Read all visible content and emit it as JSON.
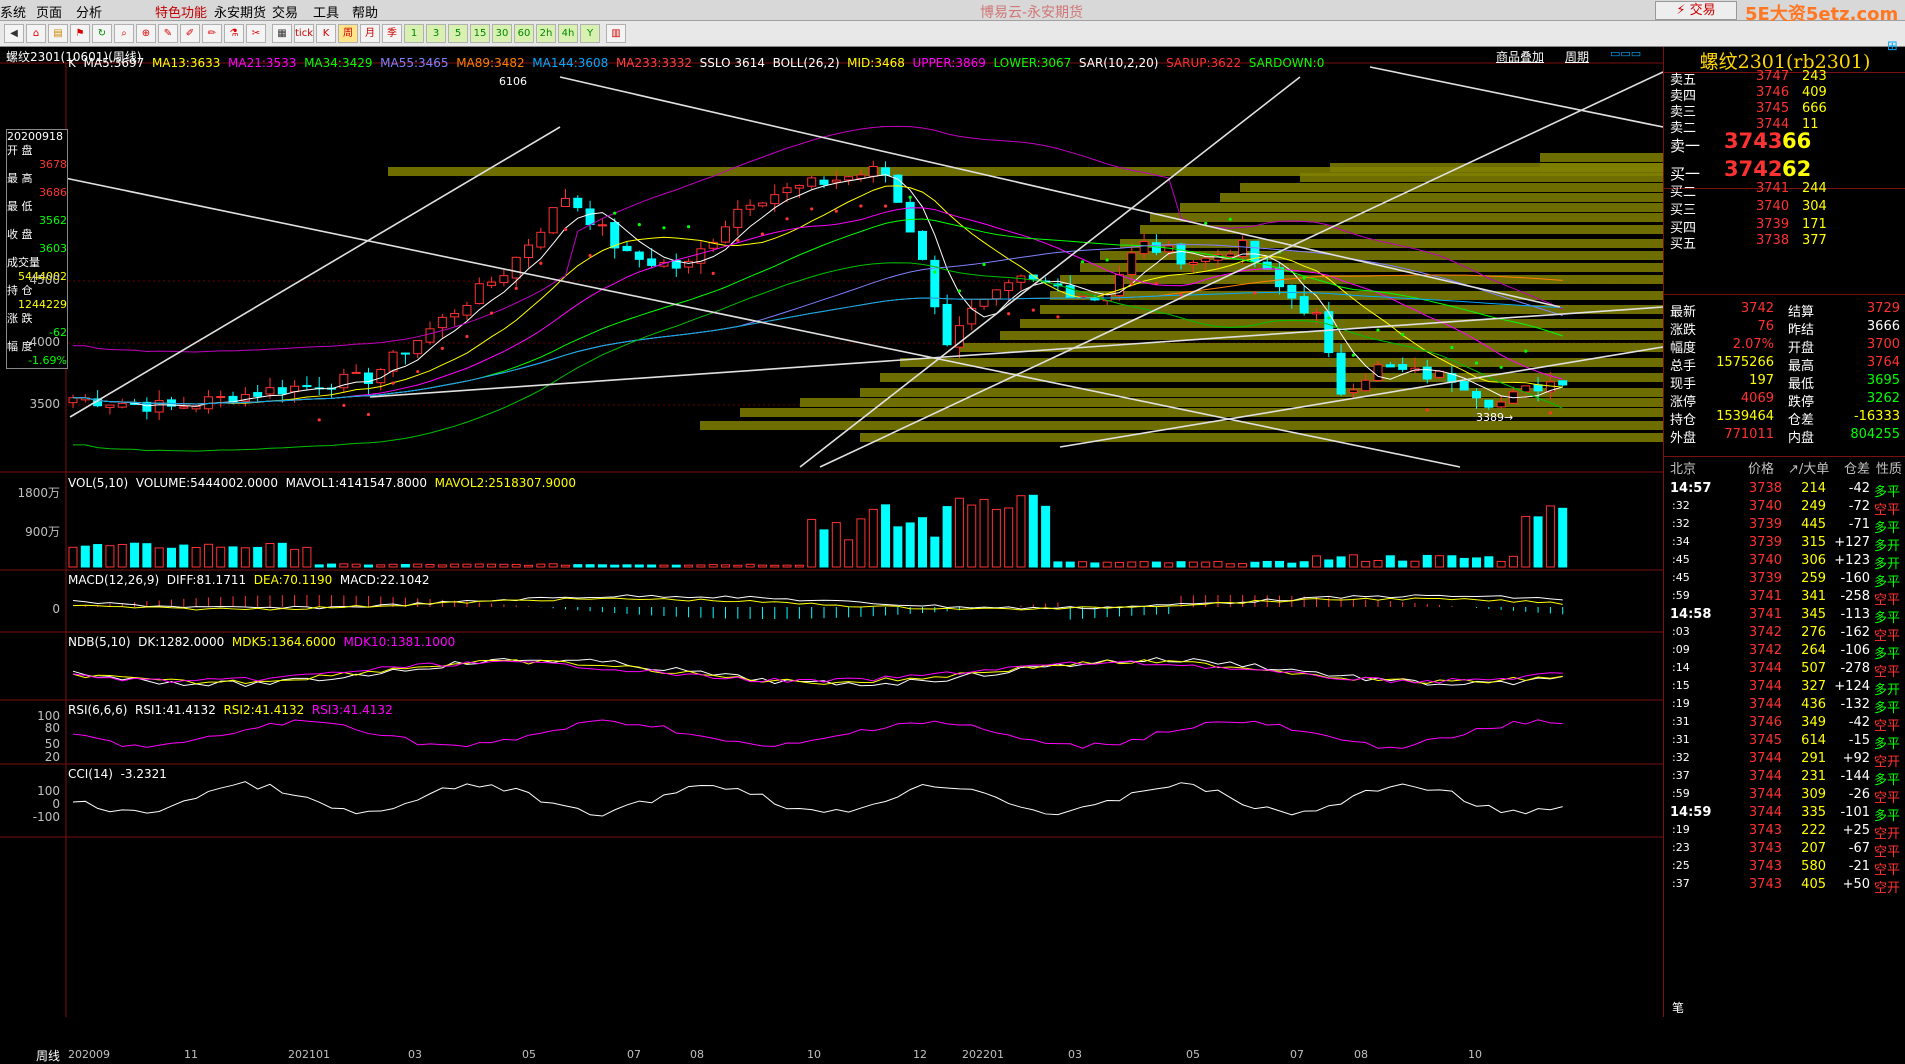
{
  "menu": {
    "items": [
      "系统",
      "页面",
      "分析",
      "特色功能",
      "永安期货",
      "交易",
      "工具",
      "帮助"
    ],
    "title": "博易云-永安期货",
    "trade": "⚡ 交易",
    "watermark": "5E大资5etz.com"
  },
  "toolbar": {
    "buttons": [
      "K",
      "周",
      "月",
      "季",
      "tick"
    ],
    "active": "周"
  },
  "header": {
    "symbol": "螺纹2301(10601)(周线)",
    "overlay_link": "商品叠加",
    "period_link": "周期"
  },
  "main_legend": {
    "k": "K",
    "ma5": "MA5:3697",
    "ma13": "MA13:3633",
    "ma21": "MA21:3533",
    "ma34": "MA34:3429",
    "ma55": "MA55:3465",
    "ma89": "MA89:3482",
    "ma144": "MA144:3608",
    "ma233": "MA233:3332",
    "sslo": "SSLO 3614",
    "boll": "BOLL(26,2)",
    "mid": "MID:3468",
    "upper": "UPPER:3869",
    "lower": "LOWER:3067",
    "sar": "SAR(10,2,20)",
    "sarup": "SARUP:3622",
    "sardown": "SARDOWN:0"
  },
  "info_box": {
    "date": "20200918",
    "open_label": "开  盘",
    "open": "3678",
    "high_label": "最  高",
    "high": "3686",
    "low_label": "最  低",
    "low": "3562",
    "close_label": "收  盘",
    "close": "3603",
    "vol_label": "成交量",
    "vol": "5444002",
    "oi_label": "持  仓",
    "oi": "1244229",
    "chg_label": "涨  跌",
    "chg": "-62",
    "pct_label": "幅  度",
    "pct": "-1.69%"
  },
  "y_axis_main": [
    "4500",
    "4000",
    "3500"
  ],
  "annotations": {
    "high": "6106",
    "low": "3389→"
  },
  "vol_legend": {
    "name": "VOL(5,10)",
    "volume": "VOLUME:5444002.0000",
    "mavol1": "MAVOL1:4141547.8000",
    "mavol2": "MAVOL2:2518307.9000",
    "y1": "1800万",
    "y2": "900万"
  },
  "macd_legend": {
    "name": "MACD(12,26,9)",
    "diff": "DIFF:81.1711",
    "dea": "DEA:70.1190",
    "macd": "MACD:22.1042",
    "y0": "0"
  },
  "ndb_legend": {
    "name": "NDB(5,10)",
    "dk": "DK:1282.0000",
    "mdk5": "MDK5:1364.6000",
    "mdk10": "MDK10:1381.1000"
  },
  "rsi_legend": {
    "name": "RSI(6,6,6)",
    "rsi1": "RSI1:41.4132",
    "rsi2": "RSI2:41.4132",
    "rsi3": "RSI3:41.4132",
    "y": [
      "100",
      "80",
      "50",
      "20"
    ]
  },
  "cci_legend": {
    "name": "CCI(14)",
    "value": "-3.2321",
    "y": [
      "100",
      "0",
      "-100"
    ]
  },
  "x_axis": {
    "label": "周线",
    "ticks": [
      "202009",
      "11",
      "202101",
      "03",
      "05",
      "07",
      "08",
      "10",
      "12",
      "202201",
      "03",
      "05",
      "07",
      "08",
      "10"
    ]
  },
  "right_panel": {
    "title": "螺纹2301(rb2301)",
    "asks": [
      [
        "卖五",
        "3747",
        "243"
      ],
      [
        "卖四",
        "3746",
        "409"
      ],
      [
        "卖三",
        "3745",
        "666"
      ],
      [
        "卖二",
        "3744",
        "11"
      ],
      [
        "卖一",
        "3743",
        "66"
      ]
    ],
    "bids": [
      [
        "买一",
        "3742",
        "62"
      ],
      [
        "买二",
        "3741",
        "244"
      ],
      [
        "买三",
        "3740",
        "304"
      ],
      [
        "买四",
        "3739",
        "171"
      ],
      [
        "买五",
        "3738",
        "377"
      ]
    ],
    "stats": [
      [
        "最新",
        "3742",
        "结算",
        "3729"
      ],
      [
        "涨跌",
        "76",
        "昨结",
        "3666"
      ],
      [
        "幅度",
        "2.07%",
        "开盘",
        "3700"
      ],
      [
        "总手",
        "1575266",
        "最高",
        "3764"
      ],
      [
        "现手",
        "197",
        "最低",
        "3695"
      ],
      [
        "涨停",
        "4069",
        "跌停",
        "3262"
      ],
      [
        "持仓",
        "1539464",
        "仓差",
        "-16333"
      ],
      [
        "外盘",
        "771011",
        "内盘",
        "804255"
      ]
    ],
    "tick_header": [
      "北京",
      "价格",
      "↗/大单",
      "仓差",
      "性质"
    ],
    "ticks": [
      [
        "14:57",
        "3738",
        "214",
        "-42",
        "多平"
      ],
      [
        ":32",
        "3740",
        "249",
        "-72",
        "空平"
      ],
      [
        ":32",
        "3739",
        "445",
        "-71",
        "多平"
      ],
      [
        ":34",
        "3739",
        "315",
        "+127",
        "多开"
      ],
      [
        ":45",
        "3740",
        "306",
        "+123",
        "多开"
      ],
      [
        ":45",
        "3739",
        "259",
        "-160",
        "多平"
      ],
      [
        ":59",
        "3741",
        "341",
        "-258",
        "空平"
      ],
      [
        "14:58",
        "3741",
        "345",
        "-113",
        "多平"
      ],
      [
        ":03",
        "3742",
        "276",
        "-162",
        "空平"
      ],
      [
        ":09",
        "3742",
        "264",
        "-106",
        "多平"
      ],
      [
        ":14",
        "3744",
        "507",
        "-278",
        "空平"
      ],
      [
        ":15",
        "3744",
        "327",
        "+124",
        "多开"
      ],
      [
        ":19",
        "3744",
        "436",
        "-132",
        "多平"
      ],
      [
        ":31",
        "3746",
        "349",
        "-42",
        "空平"
      ],
      [
        ":31",
        "3745",
        "614",
        "-15",
        "多平"
      ],
      [
        ":32",
        "3744",
        "291",
        "+92",
        "空开"
      ],
      [
        ":37",
        "3744",
        "231",
        "-144",
        "多平"
      ],
      [
        ":59",
        "3744",
        "309",
        "-26",
        "空平"
      ],
      [
        "14:59",
        "3744",
        "335",
        "-101",
        "多平"
      ],
      [
        ":19",
        "3743",
        "222",
        "+25",
        "空开"
      ],
      [
        ":23",
        "3743",
        "207",
        "-67",
        "空平"
      ],
      [
        ":25",
        "3743",
        "580",
        "-21",
        "空平"
      ],
      [
        ":37",
        "3743",
        "405",
        "+50",
        "空开"
      ]
    ],
    "footer": "笔"
  },
  "colors": {
    "up": "#ff3232",
    "down": "#00ffff",
    "ma5": "#ffffff",
    "ma13": "#ffff00",
    "ma21": "#ff00ff",
    "ma34": "#00ff00",
    "ma55": "#8080ff",
    "ma89": "#ff8000",
    "ma144": "#00aaff",
    "ma233": "#ff4040",
    "vbar": "#808000",
    "sar": "#00ff00"
  }
}
